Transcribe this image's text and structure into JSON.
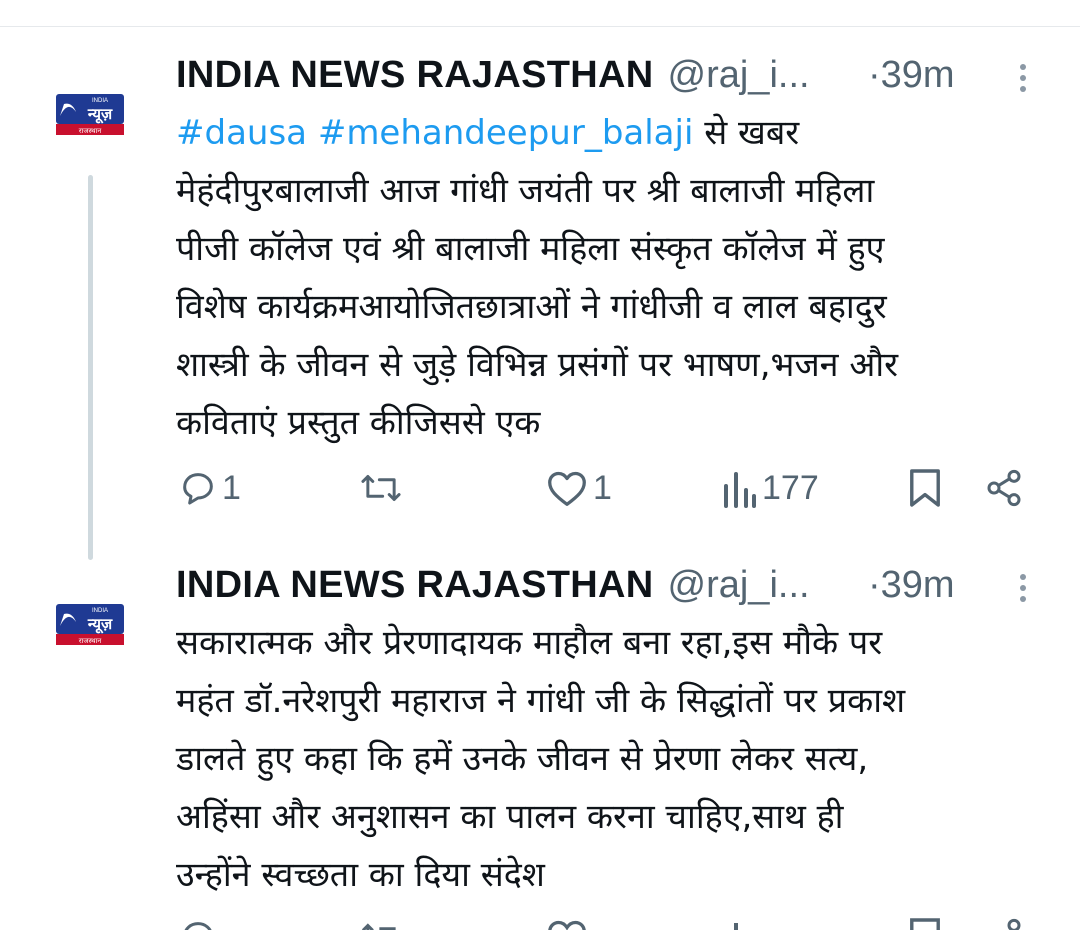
{
  "tweets": [
    {
      "name": "INDIA NEWS RAJASTHAN",
      "handle": "@raj_i...",
      "time": "·39m",
      "hashtag1": "#dausa",
      "hashtag2": "#mehandeepur_balaji",
      "first_line_rest": " से खबर",
      "body": "मेहंदीपुरबालाजी आज गांधी जयंती पर श्री बालाजी महिला\nपीजी कॉलेज एवं श्री बालाजी महिला संस्कृत कॉलेज में हुए\nविशेष कार्यक्रमआयोजितछात्राओं ने गांधीजी व लाल बहादुर\nशास्त्री के जीवन से जुड़े विभिन्न प्रसंगों पर भाषण,भजन और\nकविताएं प्रस्तुत कीजिससे एक",
      "replies": "1",
      "reposts": "",
      "likes": "1",
      "views": "177"
    },
    {
      "name": "INDIA NEWS RAJASTHAN",
      "handle": "@raj_i...",
      "time": "·39m",
      "body": "सकारात्मक और प्रेरणादायक माहौल बना रहा,इस मौके पर\nमहंत डॉ.नरेशपुरी महाराज ने गांधी जी के सिद्धांतों पर प्रकाश\nडालते हुए कहा कि हमें उनके जीवन से प्रेरणा लेकर सत्य,\nअहिंसा और अनुशासन का पालन करना चाहिए,साथ ही\nउन्होंने स्वच्छता का दिया संदेश"
    }
  ],
  "avatar_logo": {
    "top_text": "INDIA",
    "main_text": "न्यूज़",
    "bottom_text": "राजस्थान"
  },
  "colors": {
    "link": "#1d9bf0",
    "muted": "#536471",
    "logo_red": "#c8102e",
    "logo_blue": "#1f3a93"
  },
  "icons": [
    "reply-icon",
    "repost-icon",
    "like-icon",
    "views-icon",
    "bookmark-icon",
    "share-icon",
    "more-icon"
  ]
}
